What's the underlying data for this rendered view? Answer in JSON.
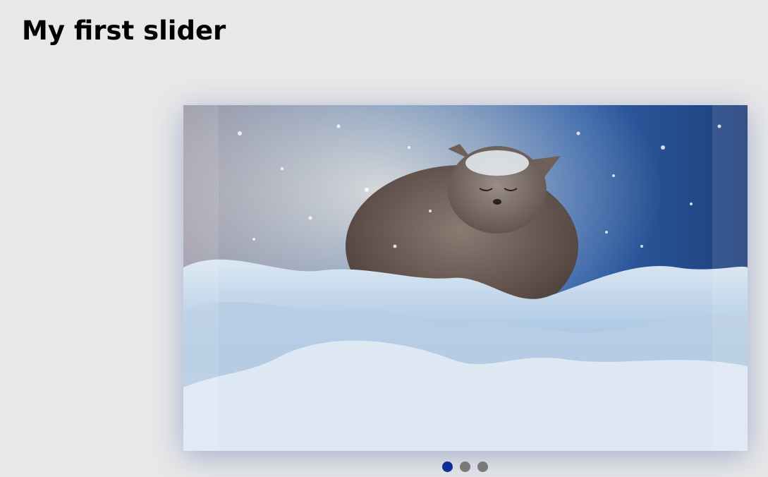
{
  "page": {
    "title": "My first slider"
  },
  "slider": {
    "slides": [
      {
        "image": "cat-in-snow-photo"
      },
      {
        "image": "slide-2"
      },
      {
        "image": "slide-3"
      }
    ],
    "active_index": 0,
    "dot_count": 3,
    "colors": {
      "active_dot": "#0b2f99",
      "inactive_dot": "#7a7a7a",
      "background": "#e8e8e8"
    }
  }
}
